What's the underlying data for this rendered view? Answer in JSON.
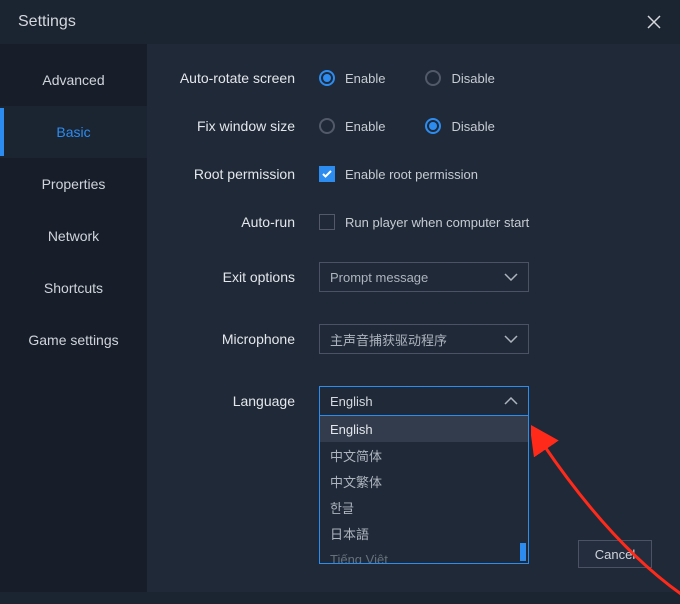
{
  "header": {
    "title": "Settings"
  },
  "sidebar": {
    "items": [
      {
        "label": "Advanced"
      },
      {
        "label": "Basic"
      },
      {
        "label": "Properties"
      },
      {
        "label": "Network"
      },
      {
        "label": "Shortcuts"
      },
      {
        "label": "Game settings"
      }
    ],
    "active_index": 1
  },
  "settings": {
    "auto_rotate": {
      "label": "Auto-rotate screen",
      "enable_label": "Enable",
      "disable_label": "Disable",
      "value": "enable"
    },
    "fix_window": {
      "label": "Fix window size",
      "enable_label": "Enable",
      "disable_label": "Disable",
      "value": "disable"
    },
    "root_permission": {
      "label": "Root permission",
      "checkbox_label": "Enable root permission",
      "checked": true
    },
    "auto_run": {
      "label": "Auto-run",
      "checkbox_label": "Run player when computer start",
      "checked": false
    },
    "exit_options": {
      "label": "Exit options",
      "value": "Prompt message"
    },
    "microphone": {
      "label": "Microphone",
      "value": "主声音捕获驱动程序"
    },
    "language": {
      "label": "Language",
      "value": "English",
      "options": [
        "English",
        "中文简体",
        "中文繁体",
        "한글",
        "日本語",
        "Tiếng Việt"
      ],
      "selected_index": 0
    }
  },
  "footer": {
    "cancel": "Cancel"
  }
}
